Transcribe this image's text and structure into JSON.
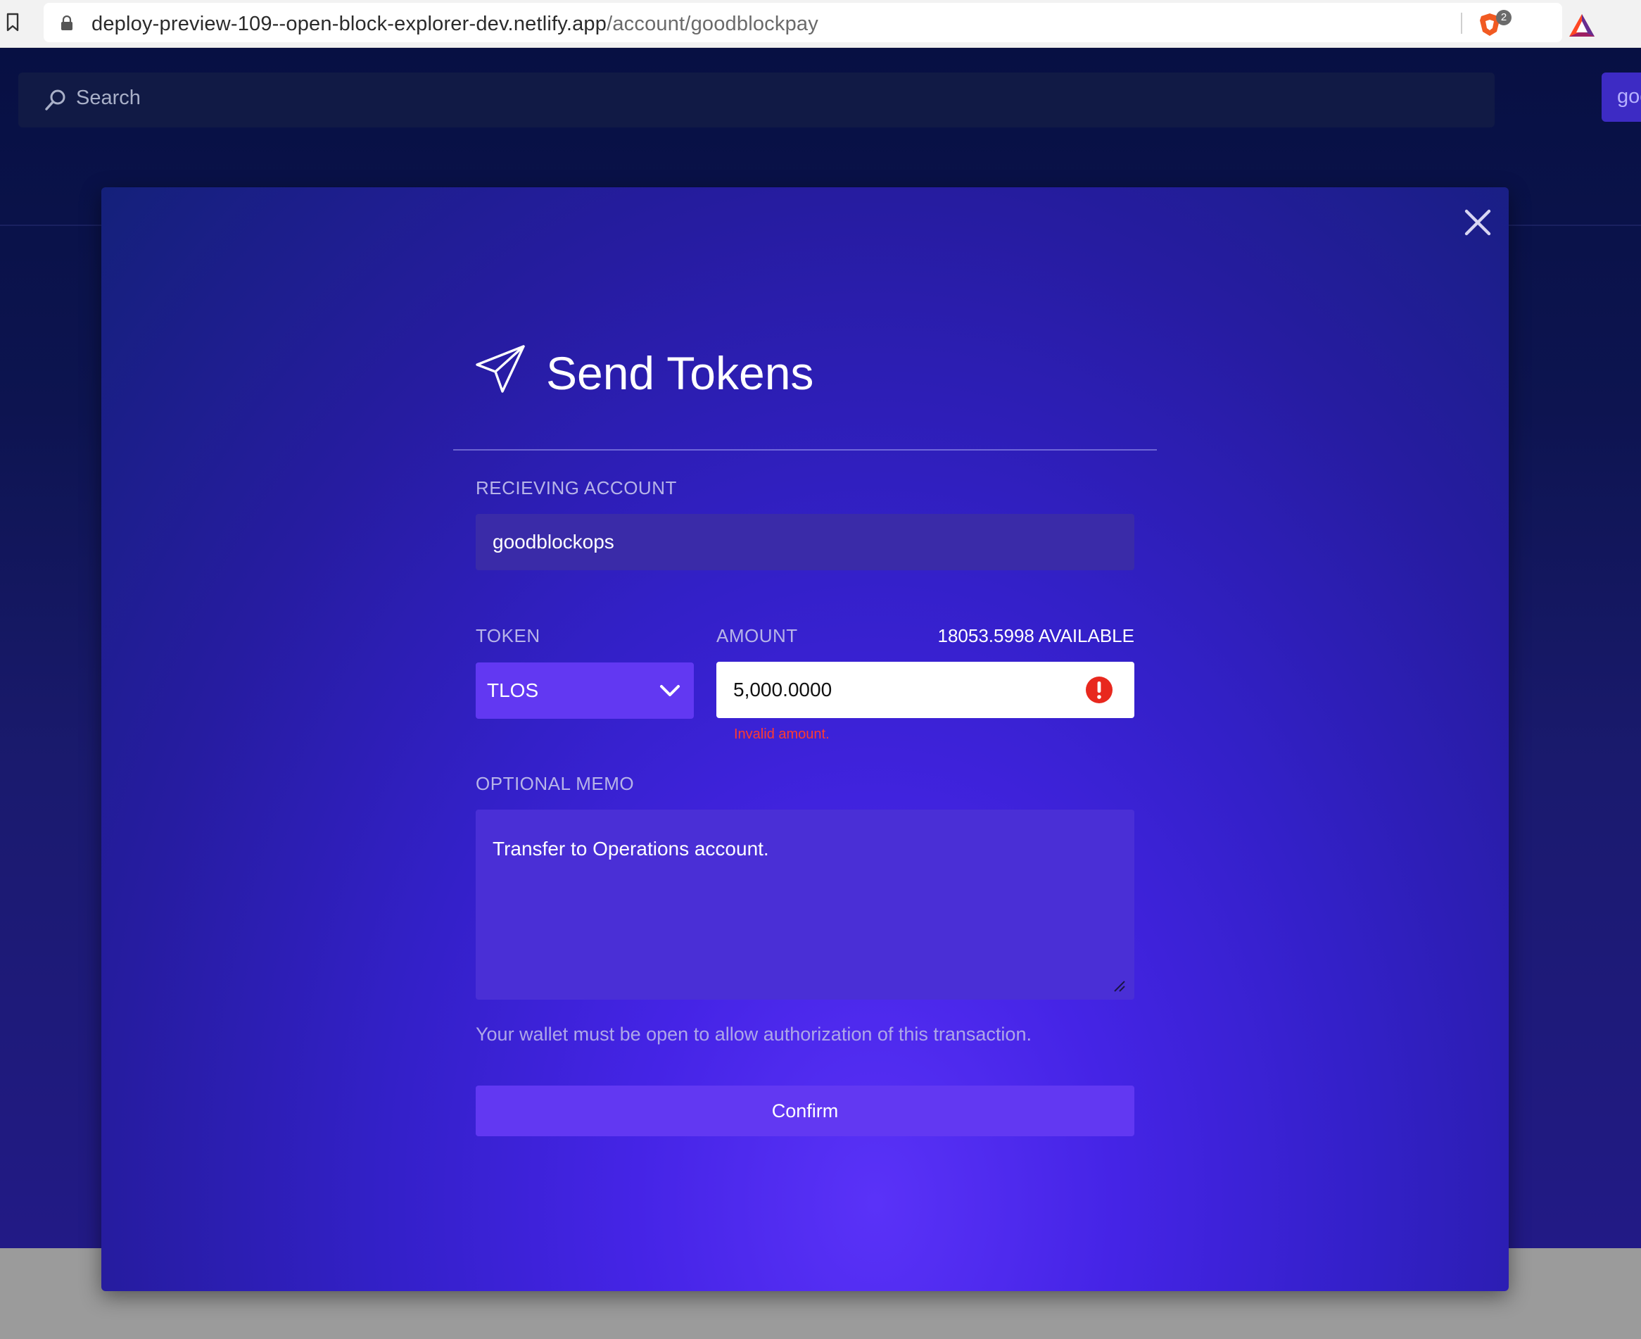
{
  "browser": {
    "url_host": "deploy-preview-109--open-block-explorer-dev.netlify.app",
    "url_path": "/account/goodblockpay",
    "extension_badge": "2"
  },
  "header": {
    "search_placeholder": "Search",
    "account_chip": "goodblockpay"
  },
  "modal": {
    "title": "Send Tokens",
    "receiving_label": "RECIEVING ACCOUNT",
    "receiving_value": "goodblockops",
    "token_label": "TOKEN",
    "token_value": "TLOS",
    "amount_label": "AMOUNT",
    "available": "18053.5998 AVAILABLE",
    "amount_value": "5,000.0000",
    "amount_error": "Invalid amount.",
    "memo_label": "OPTIONAL MEMO",
    "memo_value": "Transfer to Operations account.",
    "notice": "Your wallet must be open to allow authorization of this transaction.",
    "confirm_label": "Confirm"
  },
  "colors": {
    "accent": "#6238f2",
    "error": "#ff3b30",
    "modal_gradient_center": "#5a32f8",
    "page_background": "#071043"
  },
  "icons": [
    "bookmark-icon",
    "lock-icon",
    "brave-icon",
    "bat-icon",
    "search-icon",
    "close-icon",
    "paper-plane-icon",
    "chevron-down-icon",
    "error-icon",
    "resize-handle-icon"
  ]
}
